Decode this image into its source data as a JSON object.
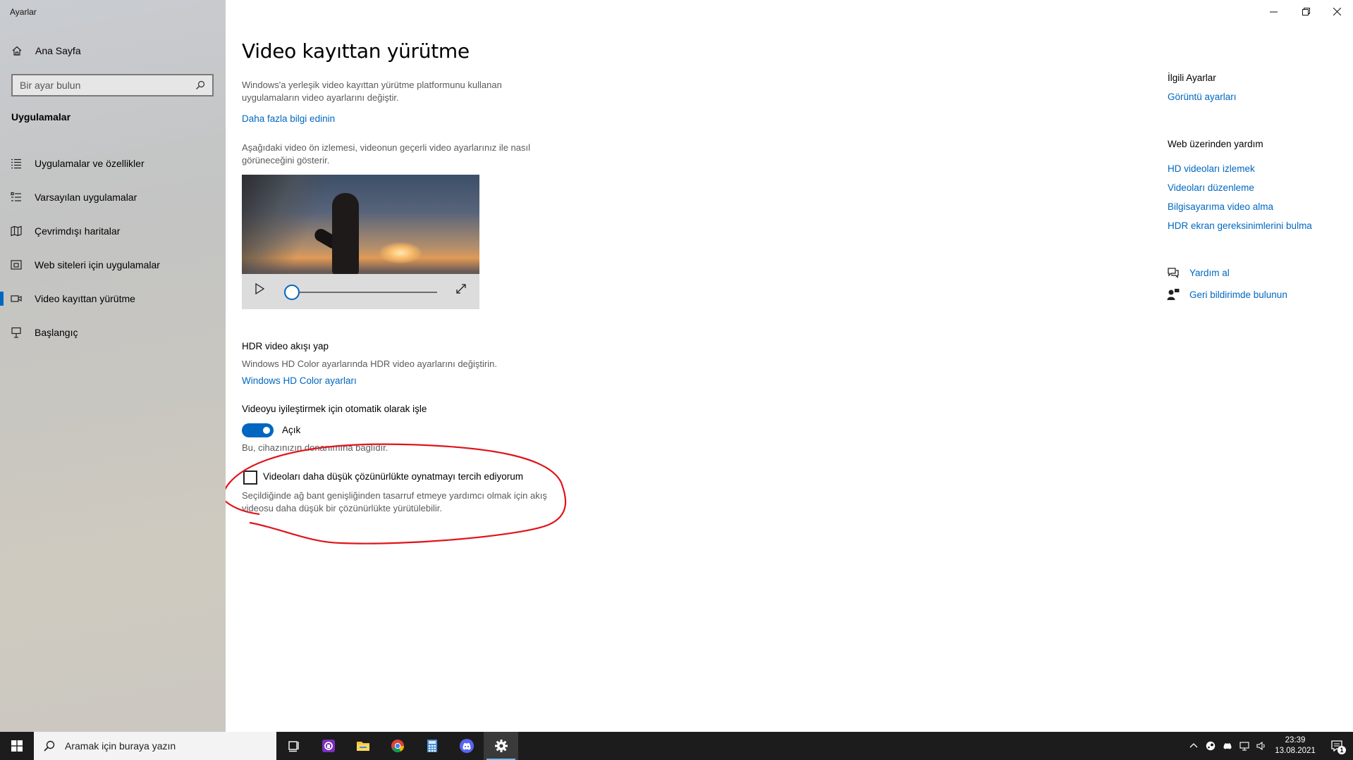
{
  "window": {
    "app_title": "Ayarlar"
  },
  "sidebar": {
    "home_label": "Ana Sayfa",
    "search_placeholder": "Bir ayar bulun",
    "section_title": "Uygulamalar",
    "items": [
      {
        "label": "Uygulamalar ve özellikler",
        "icon": "apps-list-icon"
      },
      {
        "label": "Varsayılan uygulamalar",
        "icon": "default-apps-icon"
      },
      {
        "label": "Çevrimdışı haritalar",
        "icon": "offline-maps-icon"
      },
      {
        "label": "Web siteleri için uygulamalar",
        "icon": "web-apps-icon"
      },
      {
        "label": "Video kayıttan yürütme",
        "icon": "video-playback-icon",
        "active": true
      },
      {
        "label": "Başlangıç",
        "icon": "startup-icon"
      }
    ]
  },
  "main": {
    "title": "Video kayıttan yürütme",
    "intro": "Windows'a yerleşik video kayıttan yürütme platformunu kullanan uygulamaların video ayarlarını değiştir.",
    "learn_more": "Daha fazla bilgi edinin",
    "preview_desc": "Aşağıdaki video ön izlemesi, videonun geçerli video ayarlarınız ile nasıl görüneceğini gösterir.",
    "hdr_title": "HDR video akışı yap",
    "hdr_desc": "Windows HD Color ayarlarında HDR video ayarlarını değiştirin.",
    "hdr_link": "Windows HD Color ayarları",
    "auto_process_title": "Videoyu iyileştirmek için otomatik olarak işle",
    "auto_process_state": "Açık",
    "auto_process_on": true,
    "hardware_note": "Bu, cihazınızın donanımına bağlıdır.",
    "low_res_label": "Videoları daha düşük çözünürlükte oynatmayı tercih ediyorum",
    "low_res_checked": false,
    "low_res_desc": "Seçildiğinde ağ bant genişliğinden tasarruf etmeye yardımcı olmak için akış videosu daha düşük bir çözünürlükte yürütülebilir."
  },
  "related": {
    "title": "İlgili Ayarlar",
    "links": [
      "Görüntü ayarları"
    ]
  },
  "web_help": {
    "title": "Web üzerinden yardım",
    "links": [
      "HD videoları izlemek",
      "Videoları düzenleme",
      "Bilgisayarıma video alma",
      "HDR ekran gereksinimlerini bulma"
    ]
  },
  "help": {
    "get_help": "Yardım al",
    "feedback": "Geri bildirimde bulunun"
  },
  "taskbar": {
    "search_placeholder": "Aramak için buraya yazın",
    "time": "23:39",
    "date": "13.08.2021",
    "notification_count": "1"
  },
  "colors": {
    "accent": "#0067c0",
    "annotation": "#e0141a"
  }
}
